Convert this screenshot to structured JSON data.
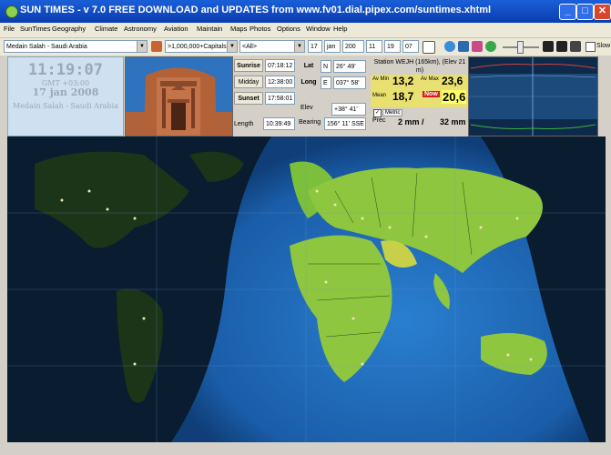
{
  "window": {
    "title": "SUN TIMES  -  v 7.0 FREE DOWNLOAD and UPDATES from www.fv01.dial.pipex.com/suntimes.xhtml"
  },
  "menu": [
    "File",
    "SunTimes",
    "Geography",
    "Climate",
    "Astronomy",
    "Aviation",
    "Maintain",
    "Maps",
    "Photos",
    "Options",
    "Window",
    "Help"
  ],
  "toolbar": {
    "location": "Medain Salah - Saudi Arabia",
    "population_filter": ">1,000,000+Capitals",
    "region_filter": "<All>",
    "date_day": "17",
    "date_month": "jan",
    "date_year": "200",
    "time_h": "11",
    "time_m": "19",
    "time_s": "07",
    "slow_label": "Slow"
  },
  "clock": {
    "time": "11:19:07",
    "gmt": "GMT +03:00",
    "date": "17 jan 2008",
    "place": "Medain Salah - Saudi Arabia"
  },
  "sun": {
    "sunrise_label": "Sunrise",
    "sunrise": "07:18:12",
    "midday_label": "Midday",
    "midday": "12:38:00",
    "sunset_label": "Sunset",
    "sunset": "17:58:01",
    "length_label": "Length",
    "length": "10:39:49"
  },
  "geo": {
    "lat_label": "Lat",
    "lat_hemi": "N",
    "lat": "26° 49'",
    "long_label": "Long",
    "long_hemi": "E",
    "long": "037° 58'",
    "elev_label": "Elev",
    "elev": "+38° 41'",
    "bearing_label": "Bearing",
    "bearing": "156° 11' SSE"
  },
  "station": {
    "header": "Station WEJH (165km), (Elev 21 m)",
    "av_min_label": "Av Min",
    "av_min": "13,2",
    "av_max_label": "Av Max",
    "av_max": "23,6",
    "mean_label": "Mean",
    "mean": "18,7",
    "now_label": "Now",
    "now": "20,6",
    "metric_label": "Metric",
    "prec_label": "Prec",
    "prec_value": "2 mm /",
    "prec_value2": "32 mm"
  },
  "colors": {
    "titlebar": "#0a3db0",
    "ocean": "#1f5fa8",
    "land": "#8ec63f",
    "night": "#0a1c30",
    "highlight_yellow": "#ffff66"
  }
}
